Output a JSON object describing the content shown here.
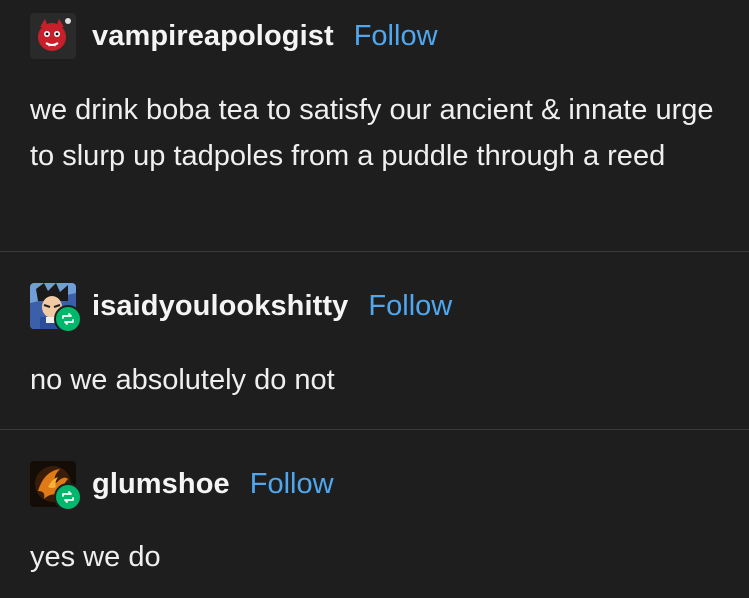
{
  "posts": [
    {
      "username": "vampireapologist",
      "follow_label": "Follow",
      "text": "we drink boba tea to satisfy our ancient & innate urge to slurp up tadpoles from a puddle through a reed",
      "reblog": false
    },
    {
      "username": "isaidyoulookshitty",
      "follow_label": "Follow",
      "text": "no we absolutely do not",
      "reblog": true
    },
    {
      "username": "glumshoe",
      "follow_label": "Follow",
      "text": "yes we do",
      "reblog": true
    }
  ],
  "colors": {
    "background": "#1e1e1e",
    "follow_link": "#4fa7ef",
    "reblog_badge": "#00b86b",
    "divider": "#3a3a3a"
  }
}
